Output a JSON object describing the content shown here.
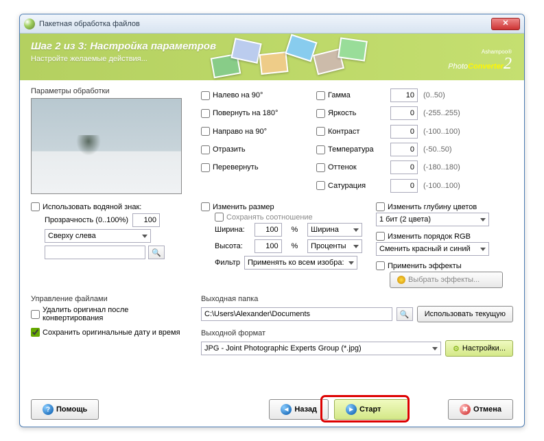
{
  "window": {
    "title": "Пакетная обработка файлов"
  },
  "banner": {
    "step": "Шаг 2 из 3: Настройка параметров",
    "subtitle": "Настройте желаемые действия...",
    "brand_small": "Ashampoo®",
    "brand_1": "Photo",
    "brand_2": "Converter"
  },
  "labels": {
    "processing_params": "Параметры обработки",
    "watermark": "Использовать водяной знак:",
    "transparency": "Прозрачность (0..100%)",
    "file_mgmt": "Управление файлами",
    "delete_original": "Удалить оригинал после конвертирования",
    "keep_datetime": "Сохранить оригинальные дату и время",
    "resize": "Изменить размер",
    "keep_ratio": "Сохранять соотношение",
    "width": "Ширина:",
    "height": "Высота:",
    "pct": "%",
    "filter": "Фильтр",
    "color_depth": "Изменить глубину цветов",
    "rgb_order": "Изменить порядок RGB",
    "apply_effects": "Применить эффекты",
    "choose_effects": "Выбрать эффекты...",
    "out_folder": "Выходная папка",
    "use_current": "Использовать текущую",
    "out_format": "Выходной формат",
    "settings": "Настройки..."
  },
  "rotate": {
    "left90": "Налево на 90°",
    "rot180": "Повернуть на 180°",
    "right90": "Направо на 90°",
    "mirror": "Отразить",
    "flip": "Перевернуть"
  },
  "adjust": {
    "gamma": "Гамма",
    "brightness": "Яркость",
    "contrast": "Контраст",
    "temperature": "Температура",
    "hue": "Оттенок",
    "saturation": "Сатурация"
  },
  "values": {
    "gamma": "10",
    "brightness": "0",
    "contrast": "0",
    "temperature": "0",
    "hue": "0",
    "saturation": "0",
    "transparency": "100",
    "wmark_pos": "Сверху слева",
    "width": "100",
    "height": "100",
    "dim_mode": "Ширина",
    "unit_mode": "Проценты",
    "filter_mode": "Применять ко всем изобра:",
    "color_depth": "1 бит (2 цвета)",
    "rgb_swap": "Сменить красный и синий",
    "out_folder": "C:\\Users\\Alexander\\Documents",
    "out_format": "JPG - Joint Photographic Experts Group (*.jpg)"
  },
  "ranges": {
    "gamma": "(0..50)",
    "brightness": "(-255..255)",
    "contrast": "(-100..100)",
    "temperature": "(-50..50)",
    "hue": "(-180..180)",
    "saturation": "(-100..100)"
  },
  "footer": {
    "help": "Помощь",
    "back": "Назад",
    "start": "Старт",
    "cancel": "Отмена"
  }
}
